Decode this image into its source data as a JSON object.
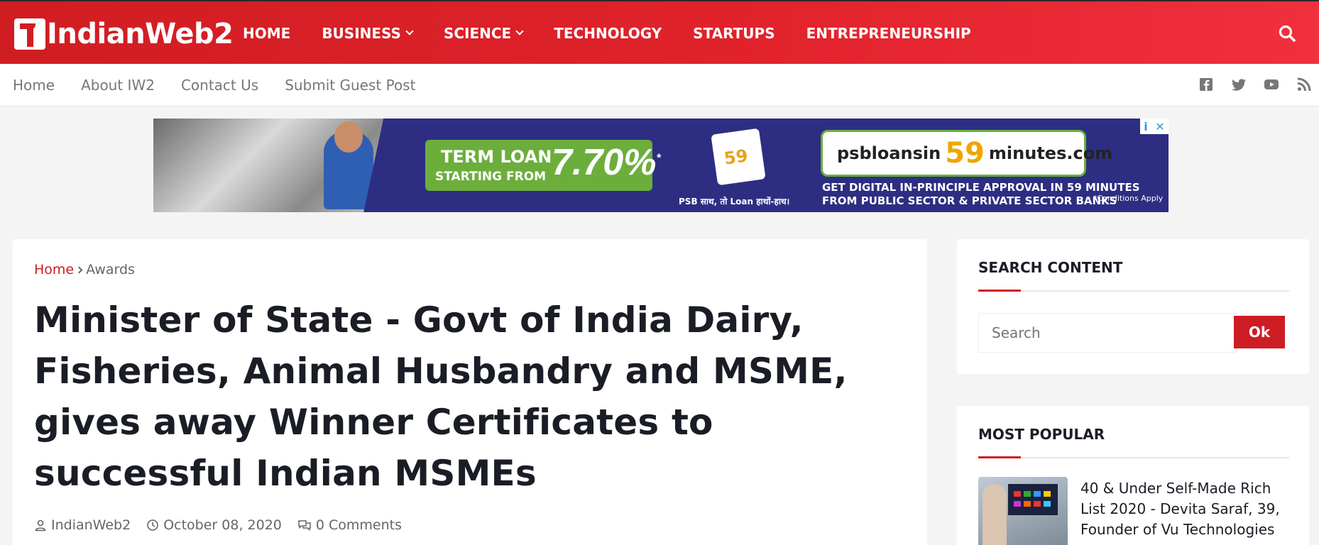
{
  "brand": {
    "logo_text": "IndianWeb2",
    "accent": "#cd1c24"
  },
  "main_nav": {
    "items": [
      {
        "label": "HOME",
        "dropdown": false
      },
      {
        "label": "BUSINESS",
        "dropdown": true
      },
      {
        "label": "SCIENCE",
        "dropdown": true
      },
      {
        "label": "TECHNOLOGY",
        "dropdown": false
      },
      {
        "label": "STARTUPS",
        "dropdown": false
      },
      {
        "label": "ENTREPRENEURSHIP",
        "dropdown": false
      }
    ],
    "search_icon": "search-icon"
  },
  "sub_nav": {
    "items": [
      "Home",
      "About IW2",
      "Contact Us",
      "Submit Guest Post"
    ],
    "social_icons": [
      "facebook-icon",
      "twitter-icon",
      "youtube-icon",
      "rss-icon"
    ]
  },
  "ad": {
    "term_line1": "TERM LOAN",
    "term_line2": "STARTING FROM",
    "rate": "7.70%",
    "rate_mark": "*",
    "psb_badge": "59",
    "psb_tagline": "PSB साथ, तो Loan हाथों-हाथ।",
    "url_prefix": "psbloansin",
    "url_number": "59",
    "url_suffix": "minutes.com",
    "line1": "GET DIGITAL IN-PRINCIPLE APPROVAL IN 59 MINUTES",
    "line2": "FROM PUBLIC SECTOR & PRIVATE SECTOR BANKS",
    "conditions": "*Conditions Apply",
    "adchoices_info": "i",
    "adchoices_close": "✕"
  },
  "article": {
    "breadcrumb_home": "Home",
    "breadcrumb_current": "Awards",
    "title": "Minister of State - Govt of India Dairy, Fisheries, Animal Husbandry and MSME, gives away Winner Certificates to successful Indian MSMEs",
    "author": "IndianWeb2",
    "date": "October 08, 2020",
    "comments": "0 Comments"
  },
  "sidebar": {
    "search_widget": {
      "title": "SEARCH CONTENT",
      "placeholder": "Search",
      "button": "Ok"
    },
    "popular_widget": {
      "title": "MOST POPULAR",
      "items": [
        {
          "title": "40 & Under Self-Made Rich List 2020 - Devita Saraf, 39, Founder of Vu Technologies"
        }
      ]
    }
  }
}
